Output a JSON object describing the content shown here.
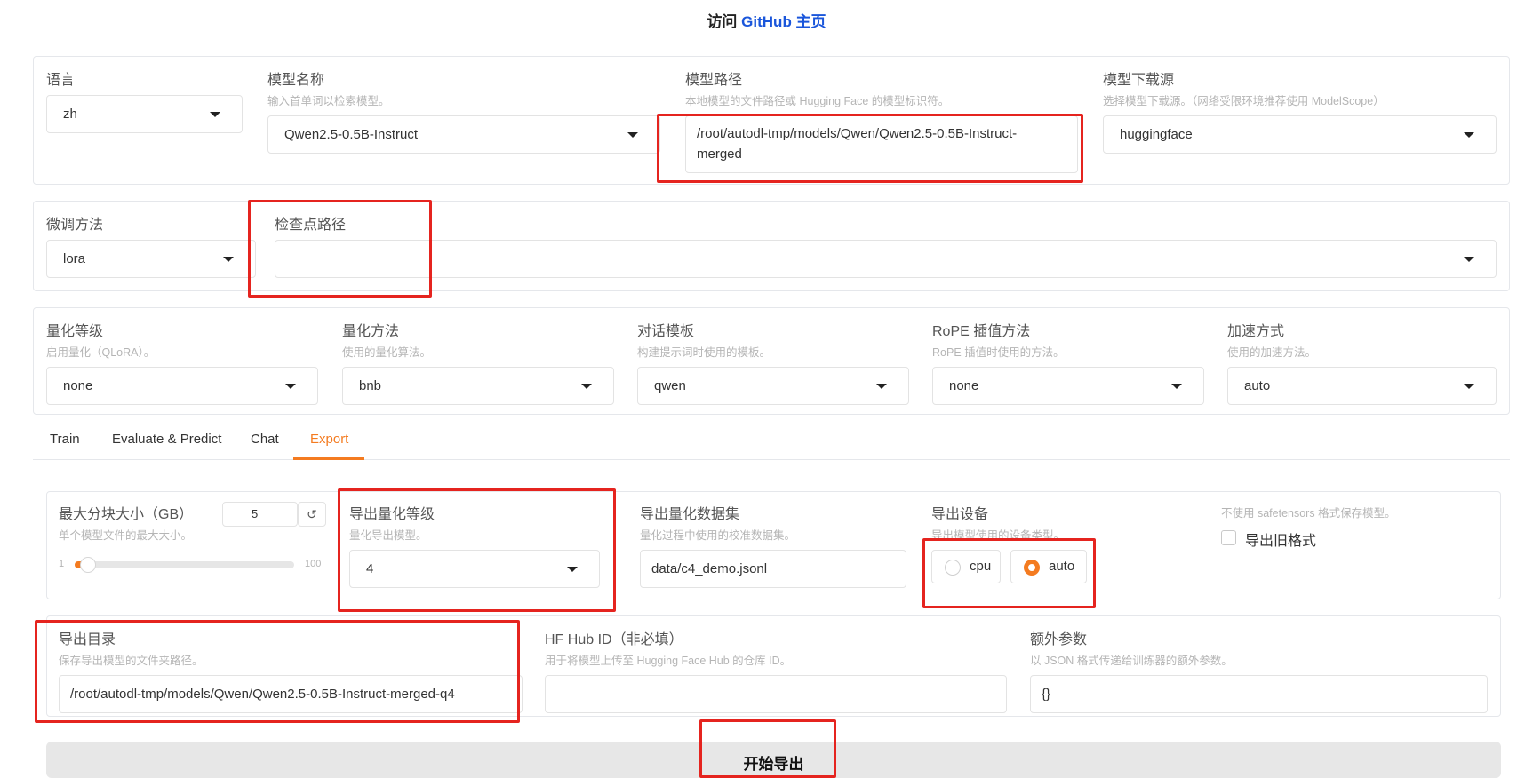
{
  "header": {
    "prefix": "访问 ",
    "link": "GitHub 主页"
  },
  "top_row": {
    "language": {
      "label": "语言",
      "value": "zh"
    },
    "model_name": {
      "label": "模型名称",
      "info": "输入首单词以检索模型。",
      "value": "Qwen2.5-0.5B-Instruct"
    },
    "model_path": {
      "label": "模型路径",
      "info": "本地模型的文件路径或 Hugging Face 的模型标识符。",
      "value_line1": "/root/autodl-tmp/models/Qwen/Qwen2.5-0.5B-Instruct-",
      "value_line2": "merged"
    },
    "download_source": {
      "label": "模型下载源",
      "info": "选择模型下载源。（网络受限环境推荐使用 ModelScope）",
      "value": "huggingface"
    }
  },
  "finetune_row": {
    "method": {
      "label": "微调方法",
      "value": "lora"
    },
    "checkpoint": {
      "label": "检查点路径",
      "value": ""
    }
  },
  "quant_row": {
    "quant_bit": {
      "label": "量化等级",
      "info": "启用量化（QLoRA）。",
      "value": "none"
    },
    "quant_method": {
      "label": "量化方法",
      "info": "使用的量化算法。",
      "value": "bnb"
    },
    "template": {
      "label": "对话模板",
      "info": "构建提示词时使用的模板。",
      "value": "qwen"
    },
    "rope": {
      "label": "RoPE 插值方法",
      "info": "RoPE 插值时使用的方法。",
      "value": "none"
    },
    "booster": {
      "label": "加速方式",
      "info": "使用的加速方法。",
      "value": "auto"
    }
  },
  "tabs": [
    {
      "label": "Train"
    },
    {
      "label": "Evaluate & Predict"
    },
    {
      "label": "Chat"
    },
    {
      "label": "Export",
      "active": true
    }
  ],
  "export": {
    "max_shard": {
      "label": "最大分块大小（GB）",
      "info": "单个模型文件的最大大小。",
      "value": "5",
      "reset": "↺",
      "min": "1",
      "max": "100",
      "fraction": 0.04
    },
    "export_quant": {
      "label": "导出量化等级",
      "info": "量化导出模型。",
      "value": "4"
    },
    "export_dataset": {
      "label": "导出量化数据集",
      "info": "量化过程中使用的校准数据集。",
      "value": "data/c4_demo.jsonl"
    },
    "export_device": {
      "label": "导出设备",
      "info": "导出模型使用的设备类型。",
      "options": [
        "cpu",
        "auto"
      ],
      "selected": "auto"
    },
    "legacy": {
      "info": "不使用 safetensors 格式保存模型。",
      "label": "导出旧格式",
      "checked": false
    },
    "export_dir": {
      "label": "导出目录",
      "info": "保存导出模型的文件夹路径。",
      "value": "/root/autodl-tmp/models/Qwen/Qwen2.5-0.5B-Instruct-merged-q4"
    },
    "hub_id": {
      "label": "HF Hub ID（非必填）",
      "info": "用于将模型上传至 Hugging Face Hub 的仓库 ID。",
      "value": ""
    },
    "extra_args": {
      "label": "额外参数",
      "info": "以 JSON 格式传递给训练器的额外参数。",
      "value": "{}"
    },
    "start_button": "开始导出"
  },
  "colors": {
    "accent": "#f47b20",
    "highlight": "#e5241f",
    "link": "#1a56db"
  }
}
